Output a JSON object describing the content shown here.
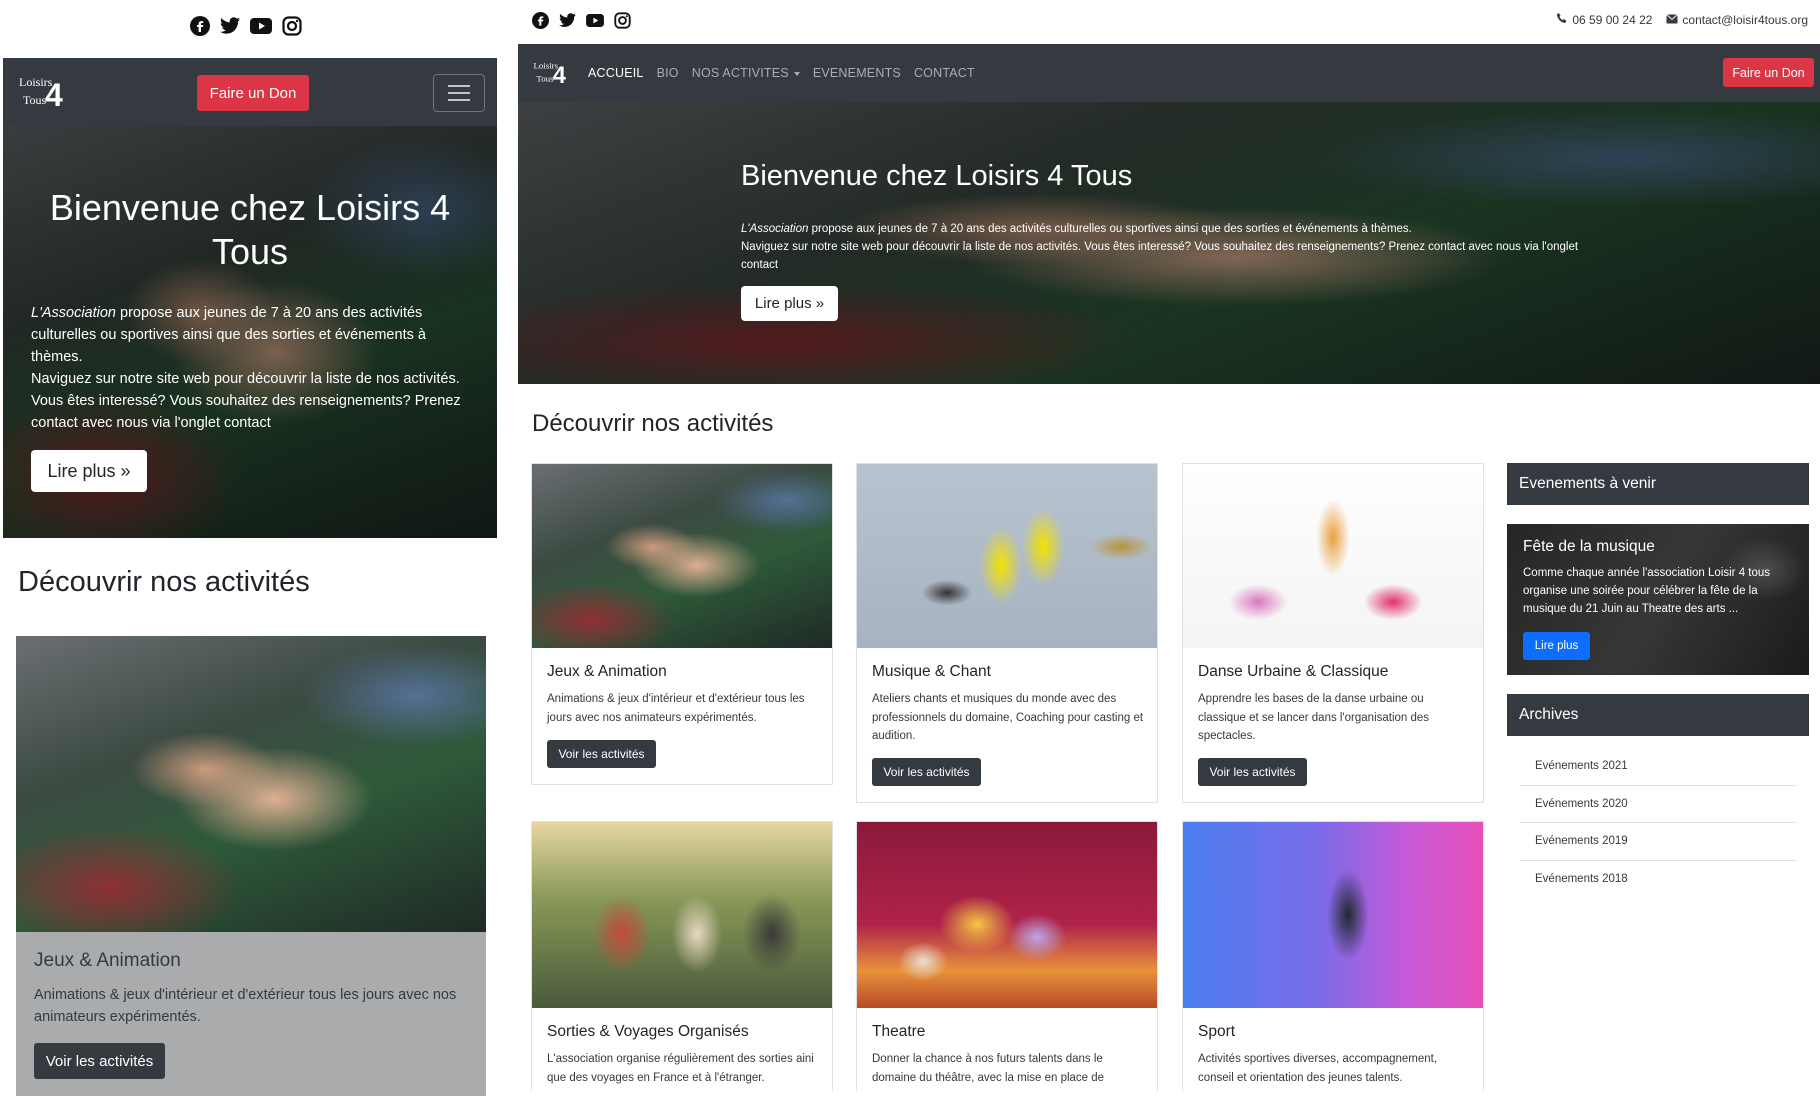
{
  "brand": {
    "logo_line1": "Loisirs",
    "logo_line2": "Tous",
    "logo_number": "4"
  },
  "social_icons": [
    "facebook-icon",
    "twitter-icon",
    "youtube-icon",
    "instagram-icon"
  ],
  "colors": {
    "navbar": "#343a40",
    "donate": "#dc3545",
    "primary": "#0d6efd"
  },
  "topbar": {
    "phone": "06 59 00 24 22",
    "email": "contact@loisir4tous.org"
  },
  "nav": {
    "items": [
      "ACCUEIL",
      "BIO",
      "NOS ACTIVITES",
      "EVENEMENTS",
      "CONTACT"
    ],
    "active": "ACCUEIL",
    "donate_label": "Faire un Don"
  },
  "hero": {
    "title_desktop": "Bienvenue chez Loisirs 4 Tous",
    "title_mobile": "Bienvenue chez Loisirs 4 Tous",
    "lead_em": "L'Association",
    "lead_rest": " propose aux jeunes de 7 à 20 ans des activités culturelles ou sportives ainsi que des sorties et événements à thèmes.",
    "lead_line2": "Naviguez sur notre site web pour découvrir la liste de nos activités. Vous êtes interessé? Vous souhaitez des renseignements? Prenez contact avec nous via l'onglet contact",
    "cta": "Lire plus »"
  },
  "activities": {
    "title": "Découvrir nos activités",
    "button_label": "Voir les activités",
    "items": [
      {
        "title": "Jeux & Animation",
        "text": "Animations & jeux d'intérieur et d'extérieur tous les jours avec nos animateurs expérimentés."
      },
      {
        "title": "Musique & Chant",
        "text": "Ateliers chants et musiques du monde avec des professionnels du domaine, Coaching pour casting et audition."
      },
      {
        "title": "Danse Urbaine & Classique",
        "text": "Apprendre les bases de la danse urbaine ou classique et se lancer dans l'organisation des spectacles."
      },
      {
        "title": "Sorties & Voyages Organisés",
        "text": "L'association organise régulièrement des sorties aini que des voyages en France et à l'étranger."
      },
      {
        "title": "Theatre",
        "text": "Donner la chance à nos futurs talents dans le domaine du théâtre, avec la mise en place de"
      },
      {
        "title": "Sport",
        "text": "Activités sportives diverses, accompagnement, conseil et orientation des jeunes talents."
      }
    ]
  },
  "sidebar": {
    "events_title": "Evenements à venir",
    "event": {
      "title": "Fête de la musique",
      "text": "Comme chaque année l'association Loisir 4 tous organise une soirée pour célébrer la fête de la musique du 21 Juin au Theatre des arts ...",
      "button": "Lire plus"
    },
    "archives_title": "Archives",
    "archives": [
      "Evénements 2021",
      "Evénements 2020",
      "Evénements 2019",
      "Evénements 2018"
    ]
  }
}
